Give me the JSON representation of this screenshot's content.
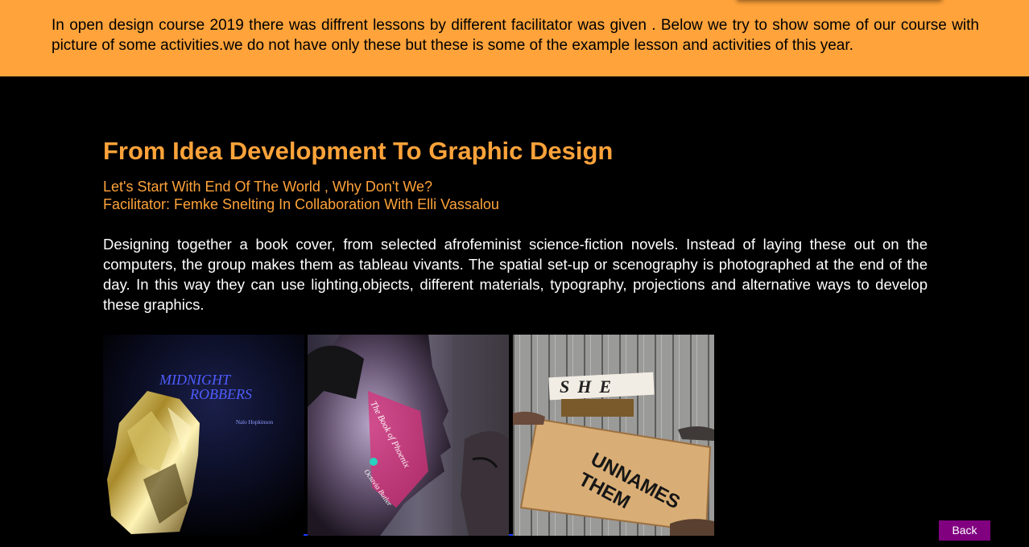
{
  "intro": {
    "text": "In open design course 2019 there was diffrent lessons by different facilitator was given . Below we try to show some of our course with picture of some activities.we do not have only these but these is some of the example lesson and activities of this year."
  },
  "lesson": {
    "title": "From Idea Development To Graphic Design",
    "subtitle": "Let's Start With End Of The World , Why Don't We?",
    "facilitator": "Facilitator: Femke Snelting In Collaboration With Elli Vassalou",
    "description": "Designing together a book cover, from selected afrofeminist science-fiction novels. Instead of laying these out on the computers, the group makes them as tableau vivants. The spatial set-up or scenography is photographed at the end of the day. In this way they can use lighting,objects, different materials, typography, projections and alternative ways to develop these graphics."
  },
  "photos": {
    "photo1": {
      "title_line1": "MIDNIGHT",
      "title_line2": "ROBBERS",
      "author": "Nalo Hopkinson"
    },
    "photo2": {
      "projection_line1": "The Book of Phoenix",
      "projection_line2": "Octavia Butler"
    },
    "photo3": {
      "sign_top": "SHE",
      "sign_bottom_line1": "UNNAMES",
      "sign_bottom_line2": "THEM"
    }
  },
  "colors": {
    "banner": "#ffa33a",
    "accent": "#ffa33a",
    "background": "#000000",
    "button": "#800080"
  },
  "back_button": {
    "label": "Back"
  }
}
